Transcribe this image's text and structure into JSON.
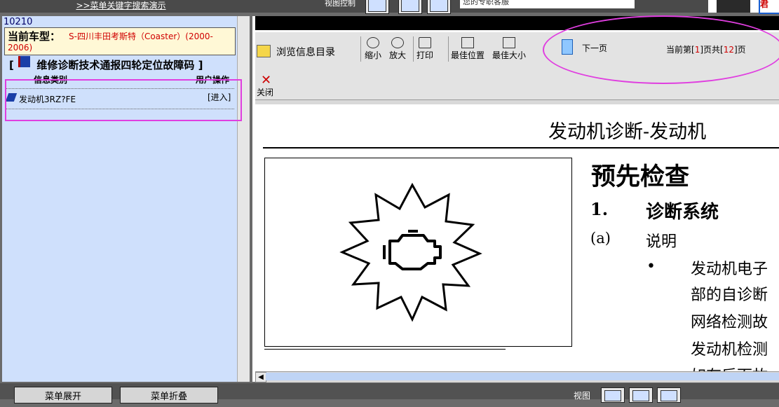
{
  "topbar": {
    "search_demo_link": ">>菜单关键字搜索演示",
    "view_control_label": "视图控制",
    "service_text": "您的专职客服",
    "logo_badge": "君"
  },
  "left": {
    "code": "10210",
    "model_label": "当前车型：",
    "model_value": "S-四川丰田考斯特（Coaster）(2000-",
    "model_value_cont": "2006)",
    "doc_title_prefix": "[",
    "doc_title": "维修诊断技术通报四轮定位故障码",
    "doc_title_suffix": "]",
    "col_category": "信息类别",
    "col_operation": "用户操作",
    "items": [
      {
        "label": "发动机3RZ?FE",
        "action": "[进入]"
      }
    ]
  },
  "toolbar": {
    "browse_label": "浏览信息目录",
    "zoom_out": "缩小",
    "zoom_in": "放大",
    "print": "打印",
    "best_position": "最佳位置",
    "best_size": "最佳大小",
    "next_page": "下一页",
    "page_prefix": "当前第[",
    "current_page": "1",
    "page_mid": "]页共[",
    "total_pages": "12",
    "page_suffix": "]页",
    "close": "关闭"
  },
  "document": {
    "heading": "发动机诊断-发动机",
    "section_title": "预先检查",
    "section_number": "1.",
    "section_name": "诊断系统",
    "sub_label": "(a)",
    "sub_text": "说明",
    "bullet": "•",
    "lines": [
      "发动机电子",
      "部的自诊断",
      "网络检测故",
      "发动机检测",
      "如有后面故"
    ]
  },
  "footer": {
    "menu_expand": "菜单展开",
    "menu_collapse": "菜单折叠",
    "view_label": "视图"
  },
  "colors": {
    "highlight": "#e03ee0",
    "panel_bg": "#cfe0fc",
    "accent_red": "#d00000"
  },
  "icons": [
    "engine-warning-icon",
    "next-arrow-icon",
    "zoom-out-icon",
    "zoom-in-icon",
    "print-icon",
    "close-icon"
  ]
}
